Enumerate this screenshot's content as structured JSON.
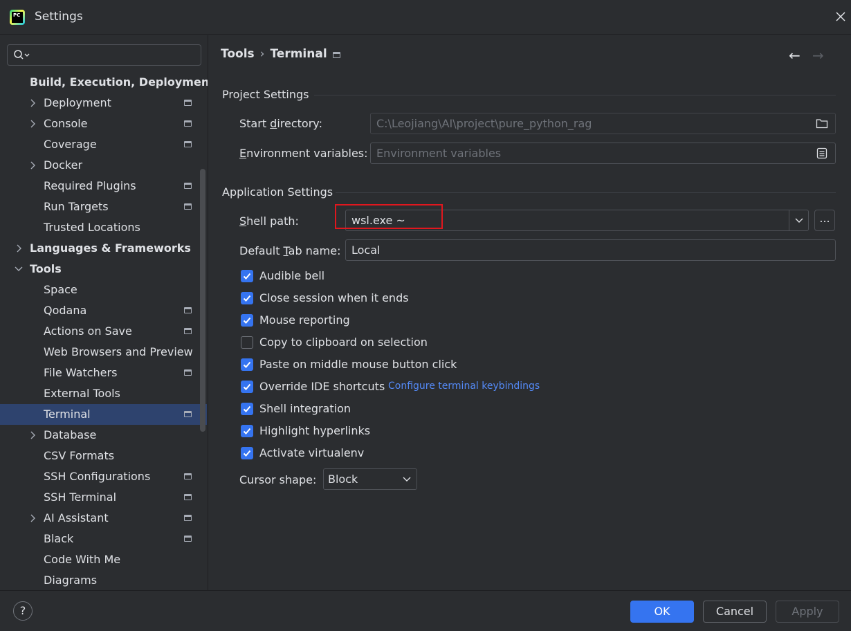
{
  "window": {
    "title": "Settings",
    "app_icon_text": "PC"
  },
  "search": {
    "placeholder": "",
    "value": ""
  },
  "sidebar": {
    "items": [
      {
        "label": "Build, Execution, Deployment",
        "level": 0,
        "bold": true,
        "expand": "none",
        "project": false
      },
      {
        "label": "Deployment",
        "level": 1,
        "expand": "collapsed",
        "project": true
      },
      {
        "label": "Console",
        "level": 1,
        "expand": "collapsed",
        "project": true
      },
      {
        "label": "Coverage",
        "level": 1,
        "expand": "none",
        "project": true
      },
      {
        "label": "Docker",
        "level": 1,
        "expand": "collapsed",
        "project": false
      },
      {
        "label": "Required Plugins",
        "level": 1,
        "expand": "none",
        "project": true
      },
      {
        "label": "Run Targets",
        "level": 1,
        "expand": "none",
        "project": true
      },
      {
        "label": "Trusted Locations",
        "level": 1,
        "expand": "none",
        "project": false
      },
      {
        "label": "Languages & Frameworks",
        "level": 0,
        "bold": true,
        "expand": "collapsed",
        "project": false
      },
      {
        "label": "Tools",
        "level": 0,
        "bold": true,
        "expand": "expanded",
        "project": false
      },
      {
        "label": "Space",
        "level": 1,
        "expand": "none",
        "project": false
      },
      {
        "label": "Qodana",
        "level": 1,
        "expand": "none",
        "project": true
      },
      {
        "label": "Actions on Save",
        "level": 1,
        "expand": "none",
        "project": true
      },
      {
        "label": "Web Browsers and Preview",
        "level": 1,
        "expand": "none",
        "project": false
      },
      {
        "label": "File Watchers",
        "level": 1,
        "expand": "none",
        "project": true
      },
      {
        "label": "External Tools",
        "level": 1,
        "expand": "none",
        "project": false
      },
      {
        "label": "Terminal",
        "level": 1,
        "expand": "none",
        "project": true,
        "selected": true
      },
      {
        "label": "Database",
        "level": 1,
        "expand": "collapsed",
        "project": false
      },
      {
        "label": "CSV Formats",
        "level": 1,
        "expand": "none",
        "project": false
      },
      {
        "label": "SSH Configurations",
        "level": 1,
        "expand": "none",
        "project": true
      },
      {
        "label": "SSH Terminal",
        "level": 1,
        "expand": "none",
        "project": true
      },
      {
        "label": "AI Assistant",
        "level": 1,
        "expand": "collapsed",
        "project": true
      },
      {
        "label": "Black",
        "level": 1,
        "expand": "none",
        "project": true
      },
      {
        "label": "Code With Me",
        "level": 1,
        "expand": "none",
        "project": false
      },
      {
        "label": "Diagrams",
        "level": 1,
        "expand": "none",
        "project": false
      }
    ]
  },
  "breadcrumb": {
    "parent": "Tools",
    "separator": "›",
    "current": "Terminal"
  },
  "nav": {
    "back": "←",
    "forward": "→"
  },
  "project_settings": {
    "title": "Project Settings",
    "start_directory": {
      "label_pre": "Start ",
      "label_mnemonic": "d",
      "label_post": "irectory:",
      "value": "C:\\Leojiang\\AI\\project\\pure_python_rag"
    },
    "env_vars": {
      "label_mnemonic": "E",
      "label_post": "nvironment variables:",
      "placeholder": "Environment variables"
    }
  },
  "application_settings": {
    "title": "Application Settings",
    "shell_path": {
      "label_mnemonic": "S",
      "label_post": "hell path:",
      "value": "wsl.exe ~",
      "browse_label": "..."
    },
    "default_tab_name": {
      "label_pre": "Default ",
      "label_mnemonic": "T",
      "label_post": "ab name:",
      "value": "Local"
    },
    "checkboxes": [
      {
        "label": "Audible bell",
        "checked": true
      },
      {
        "label": "Close session when it ends",
        "checked": true
      },
      {
        "label": "Mouse reporting",
        "checked": true
      },
      {
        "label": "Copy to clipboard on selection",
        "checked": false
      },
      {
        "label": "Paste on middle mouse button click",
        "checked": true
      },
      {
        "label": "Override IDE shortcuts",
        "checked": true
      },
      {
        "label": "Shell integration",
        "checked": true
      },
      {
        "label": "Highlight hyperlinks",
        "checked": true
      },
      {
        "label": "Activate virtualenv",
        "checked": true
      }
    ],
    "keybindings_link": "Configure terminal keybindings",
    "cursor_shape": {
      "label": "Cursor shape:",
      "value": "Block"
    }
  },
  "footer": {
    "help": "?",
    "ok": "OK",
    "cancel": "Cancel",
    "apply": "Apply"
  },
  "colors": {
    "accent": "#3574f0",
    "selection": "#2e436e",
    "link": "#548af7",
    "highlight": "#e0171e",
    "background": "#2b2d30"
  }
}
